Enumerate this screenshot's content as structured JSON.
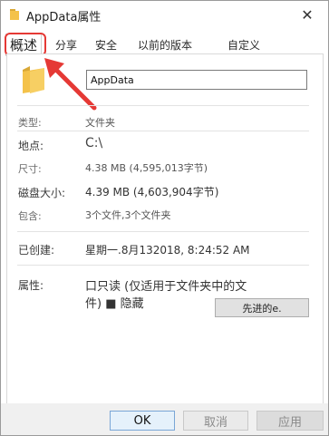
{
  "window": {
    "title": "AppData属性",
    "close_glyph": "✕"
  },
  "tabs": [
    {
      "label": "概述",
      "active": true
    },
    {
      "label": "分享"
    },
    {
      "label": "安全"
    },
    {
      "label": "以前的版本"
    },
    {
      "label": "自定义"
    }
  ],
  "general": {
    "folder_name": "AppData",
    "type_label": "类型:",
    "type_value": "文件夹",
    "location_label": "地点:",
    "location_value": "C:\\",
    "size_label": "尺寸:",
    "size_value": "4.38 MB (4,595,013字节)",
    "size_on_disk_label": "磁盘大小:",
    "size_on_disk_value": "4.39 MB (4,603,904字节)",
    "contains_label": "包含:",
    "contains_value": "3个文件,3个文件夹",
    "created_label": "已创建:",
    "created_value": "星期一.8月132018, 8:24:52 AM",
    "attributes_label": "属性:",
    "attributes_line1": "口只读 (仅适用于文件夹中的文",
    "attributes_line2": "件) ■ 隐藏",
    "advanced_label": "先进的e."
  },
  "buttons": {
    "ok": "OK",
    "cancel": "取消",
    "apply": "应用"
  },
  "colors": {
    "highlight": "#e53935",
    "folder": "#f4c24a"
  },
  "icons": {
    "title": "folder-icon",
    "large": "folder-icon",
    "annotation": "arrow-icon"
  }
}
